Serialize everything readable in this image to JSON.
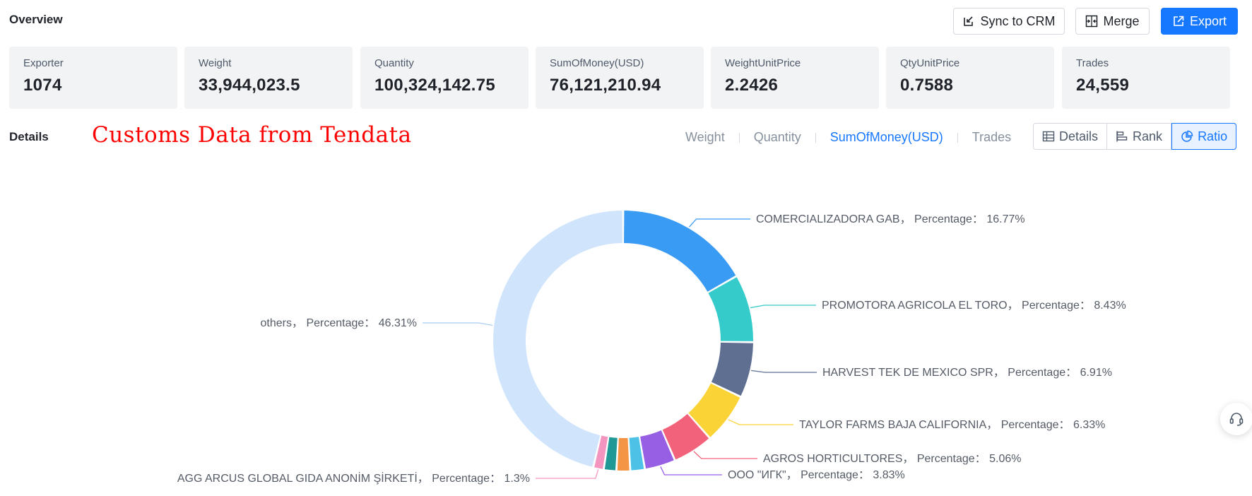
{
  "header": {
    "title": "Overview",
    "sync_label": "Sync to CRM",
    "merge_label": "Merge",
    "export_label": "Export"
  },
  "stats": [
    {
      "label": "Exporter",
      "value": "1074"
    },
    {
      "label": "Weight",
      "value": "33,944,023.5"
    },
    {
      "label": "Quantity",
      "value": "100,324,142.75"
    },
    {
      "label": "SumOfMoney(USD)",
      "value": "76,121,210.94"
    },
    {
      "label": "WeightUnitPrice",
      "value": "2.2426"
    },
    {
      "label": "QtyUnitPrice",
      "value": "0.7588"
    },
    {
      "label": "Trades",
      "value": "24,559"
    }
  ],
  "details": {
    "label": "Details",
    "watermark": "Customs Data from Tendata",
    "metric_tabs": [
      "Weight",
      "Quantity",
      "SumOfMoney(USD)",
      "Trades"
    ],
    "active_metric": "SumOfMoney(USD)",
    "view_buttons": [
      "Details",
      "Rank",
      "Ratio"
    ],
    "active_view": "Ratio"
  },
  "chart_data": {
    "type": "pie",
    "variant": "donut",
    "label_format": "{name}， Percentage： {value}%",
    "slices": [
      {
        "name": "COMERCIALIZADORA GAB",
        "value": 16.77,
        "color": "#3a9bf5"
      },
      {
        "name": "PROMOTORA AGRICOLA EL TORO",
        "value": 8.43,
        "color": "#36cbcb"
      },
      {
        "name": "HARVEST TEK DE MEXICO SPR",
        "value": 6.91,
        "color": "#5e6f92"
      },
      {
        "name": "TAYLOR FARMS BAJA CALIFORNIA",
        "value": 6.33,
        "color": "#fad337"
      },
      {
        "name": "AGROS HORTICULTORES",
        "value": 5.06,
        "color": "#f2637b"
      },
      {
        "name": "ООО \"ИГК\"",
        "value": 3.83,
        "color": "#975fe4"
      },
      {
        "name": "",
        "value": 1.8,
        "color": "#4dc2e6"
      },
      {
        "name": "",
        "value": 1.7,
        "color": "#f39545"
      },
      {
        "name": "",
        "value": 1.56,
        "color": "#1f9896"
      },
      {
        "name": "AGG ARCUS GLOBAL GIDA ANONİM ŞİRKETİ",
        "value": 1.3,
        "color": "#f495c0"
      },
      {
        "name": "others",
        "value": 46.31,
        "color": "#d0e5fc"
      }
    ]
  }
}
